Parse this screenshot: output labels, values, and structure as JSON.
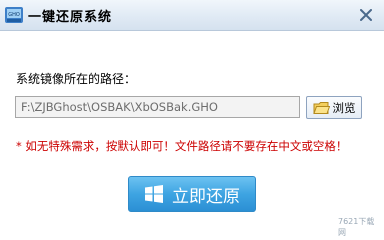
{
  "window": {
    "title": "一键还原系统",
    "icon": "onekey-restore-app-icon",
    "close_icon": "close-icon"
  },
  "form": {
    "path_label": "系统镜像所在的路径：",
    "path_value": "F:\\ZJBGhost\\OSBAK\\XbOSBak.GHO",
    "browse_label": "浏览",
    "browse_icon": "folder-icon"
  },
  "notice": "* 如无特殊需求，按默认即可！文件路径请不要存在中文或空格！",
  "restore_button": {
    "label": "立即还原",
    "icon": "windows-logo-icon"
  },
  "watermark": {
    "text": "7621下载网"
  },
  "colors": {
    "notice": "#cc0000",
    "restore_button": "#3ea4e2",
    "titlebar": "#dfe9f4"
  }
}
